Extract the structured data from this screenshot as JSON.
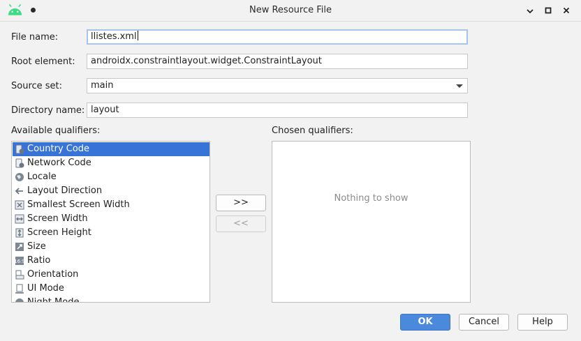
{
  "window": {
    "title": "New Resource File",
    "android_logo_icon": "android-logo",
    "controls": [
      "minimize-icon",
      "maximize-icon",
      "close-icon"
    ]
  },
  "form": {
    "file_name_label": "File name:",
    "file_name_value": "llistes.xml",
    "root_element_label": "Root element:",
    "root_element_value": "androidx.constraintlayout.widget.ConstraintLayout",
    "source_set_label": "Source set:",
    "source_set_value": "main",
    "directory_name_label": "Directory name:",
    "directory_name_value": "layout"
  },
  "qualifiers": {
    "available_label": "Available qualifiers:",
    "chosen_label": "Chosen qualifiers:",
    "chosen_empty_text": "Nothing to show",
    "available": [
      {
        "label": "Country Code",
        "icon": "country-code-icon",
        "selected": true
      },
      {
        "label": "Network Code",
        "icon": "network-code-icon",
        "selected": false
      },
      {
        "label": "Locale",
        "icon": "globe-icon",
        "selected": false
      },
      {
        "label": "Layout Direction",
        "icon": "arrow-left-icon",
        "selected": false
      },
      {
        "label": "Smallest Screen Width",
        "icon": "resize-arrows-icon",
        "selected": false
      },
      {
        "label": "Screen Width",
        "icon": "width-arrows-icon",
        "selected": false
      },
      {
        "label": "Screen Height",
        "icon": "height-arrows-icon",
        "selected": false
      },
      {
        "label": "Size",
        "icon": "size-icon",
        "selected": false
      },
      {
        "label": "Ratio",
        "icon": "ratio-icon",
        "selected": false
      },
      {
        "label": "Orientation",
        "icon": "orientation-icon",
        "selected": false
      },
      {
        "label": "UI Mode",
        "icon": "ui-mode-icon",
        "selected": false
      },
      {
        "label": "Night Mode",
        "icon": "night-mode-icon",
        "selected": false
      }
    ],
    "add_button": ">>",
    "remove_button": "<<"
  },
  "buttons": {
    "ok": "OK",
    "cancel": "Cancel",
    "help": "Help"
  },
  "colors": {
    "selection": "#3874d8",
    "primary_button": "#4a89dc",
    "android_green": "#3ddc84"
  }
}
